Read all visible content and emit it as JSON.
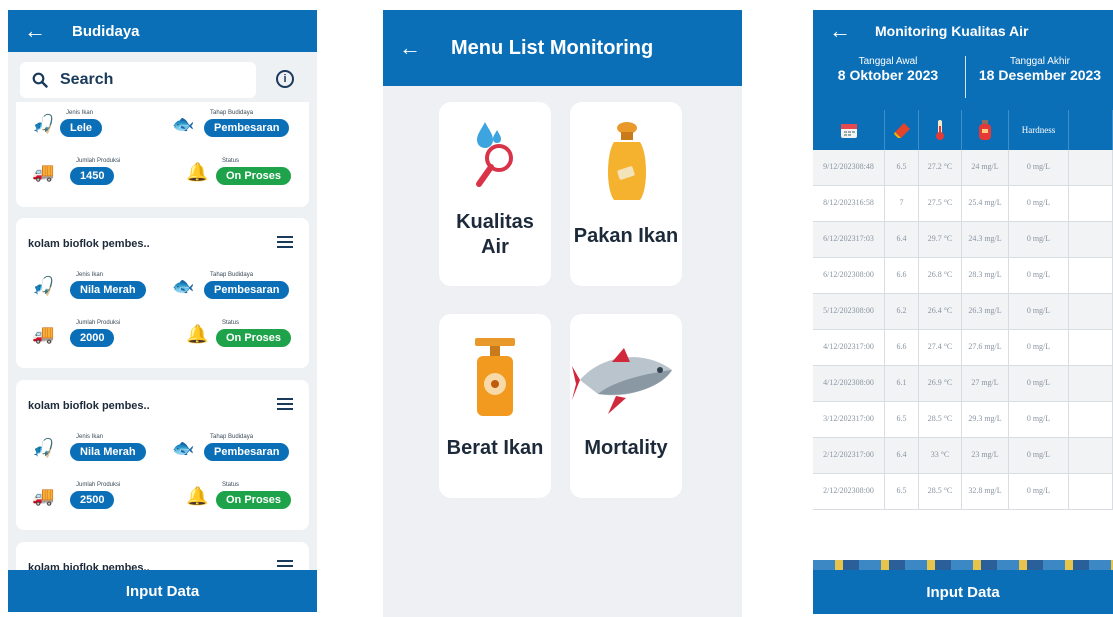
{
  "screen1": {
    "title": "Budidaya",
    "search_placeholder": "Search",
    "labels": {
      "jenis": "Jenis Ikan",
      "tahap": "Tahap Budidaya",
      "jumlah": "Jumlah Produksi",
      "status": "Status"
    },
    "cards": [
      {
        "title": "",
        "jenis_ikan": "Lele",
        "tahap_budidaya": "Pembesaran",
        "jumlah_produksi": "1450",
        "status": "On Proses"
      },
      {
        "title": "kolam bioflok pembes..",
        "jenis_ikan": "Nila Merah",
        "tahap_budidaya": "Pembesaran",
        "jumlah_produksi": "2000",
        "status": "On Proses"
      },
      {
        "title": "kolam bioflok pembes..",
        "jenis_ikan": "Nila Merah",
        "tahap_budidaya": "Pembesaran",
        "jumlah_produksi": "2500",
        "status": "On Proses"
      },
      {
        "title": "kolam bioflok pembes.."
      }
    ],
    "button_label": "Input Data"
  },
  "screen2": {
    "title": "Menu List Monitoring",
    "tiles": [
      {
        "label_line1": "Kualitas",
        "label_line2": "Air",
        "icon": "water-drop-magnifier-icon"
      },
      {
        "label_line1": "Pakan Ikan",
        "label_line2": "",
        "icon": "feed-sack-icon"
      },
      {
        "label_line1": "Berat Ikan",
        "label_line2": "",
        "icon": "scale-icon"
      },
      {
        "label_line1": "Mortality",
        "label_line2": "",
        "icon": "fish-icon"
      }
    ]
  },
  "screen3": {
    "title": "Monitoring Kualitas Air",
    "tanggal_awal_label": "Tanggal Awal",
    "tanggal_awal": "8 Oktober 2023",
    "tanggal_akhir_label": "Tanggal Akhir",
    "tanggal_akhir": "18 Desember 2023",
    "hardness_header": "Hardness",
    "rows": [
      {
        "date": "9/12/2023",
        "time": "08:48",
        "ph": "6.5",
        "temp": "27.2 °C",
        "o2": "24 mg/L",
        "hardness": "0 mg/L"
      },
      {
        "date": "8/12/2023",
        "time": "16:58",
        "ph": "7",
        "temp": "27.5 °C",
        "o2": "25.4 mg/L",
        "hardness": "0 mg/L"
      },
      {
        "date": "6/12/2023",
        "time": "17:03",
        "ph": "6.4",
        "temp": "29.7 °C",
        "o2": "24.3 mg/L",
        "hardness": "0 mg/L"
      },
      {
        "date": "6/12/2023",
        "time": "08:00",
        "ph": "6.6",
        "temp": "26.8 °C",
        "o2": "28.3 mg/L",
        "hardness": "0 mg/L"
      },
      {
        "date": "5/12/2023",
        "time": "08:00",
        "ph": "6.2",
        "temp": "26.4 °C",
        "o2": "26.3 mg/L",
        "hardness": "0 mg/L"
      },
      {
        "date": "4/12/2023",
        "time": "17:00",
        "ph": "6.6",
        "temp": "27.4 °C",
        "o2": "27.6 mg/L",
        "hardness": "0 mg/L"
      },
      {
        "date": "4/12/2023",
        "time": "08:00",
        "ph": "6.1",
        "temp": "26.9 °C",
        "o2": "27 mg/L",
        "hardness": "0 mg/L"
      },
      {
        "date": "3/12/2023",
        "time": "17:00",
        "ph": "6.5",
        "temp": "28.5 °C",
        "o2": "29.3 mg/L",
        "hardness": "0 mg/L"
      },
      {
        "date": "2/12/2023",
        "time": "17:00",
        "ph": "6.4",
        "temp": "33 °C",
        "o2": "23 mg/L",
        "hardness": "0 mg/L"
      },
      {
        "date": "2/12/2023",
        "time": "08:00",
        "ph": "6.5",
        "temp": "28.5 °C",
        "o2": "32.8 mg/L",
        "hardness": "0 mg/L"
      }
    ],
    "button_label": "Input Data"
  },
  "colors": {
    "primary": "#0b6fb8",
    "status_green": "#1fa34a",
    "background": "#eef1f4"
  }
}
